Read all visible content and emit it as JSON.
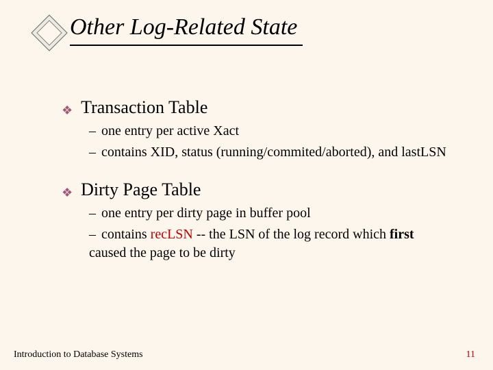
{
  "title": "Other Log-Related State",
  "bullets": {
    "b1": {
      "label": "Transaction Table",
      "s1": "one entry per active Xact",
      "s2": "contains XID, status (running/commited/aborted), and lastLSN"
    },
    "b2": {
      "label": "Dirty Page Table",
      "s1": "one entry per dirty page in buffer pool",
      "s2_pre": "contains ",
      "s2_red": "recLSN",
      "s2_mid": " -- the LSN of the log record which ",
      "s2_bold": "first",
      "s2_post": " caused the page to be dirty"
    }
  },
  "footer": {
    "left": "Introduction to Database Systems",
    "right": "11"
  }
}
